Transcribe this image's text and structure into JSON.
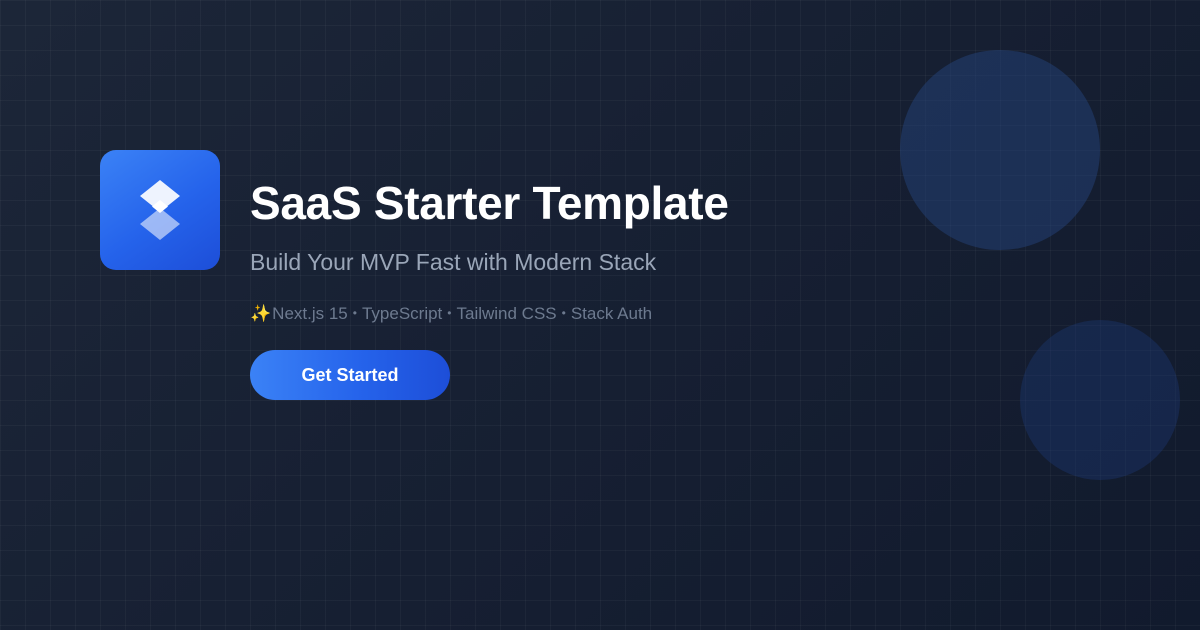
{
  "hero": {
    "title": "SaaS Starter Template",
    "subtitle": "Build Your MVP Fast with Modern Stack",
    "stack": {
      "icon": "sparkles-icon",
      "items": [
        "Next.js 15",
        "TypeScript",
        "Tailwind CSS",
        "Stack Auth"
      ],
      "separator": "•"
    },
    "cta_label": "Get Started"
  },
  "logo": {
    "icon": "layers-icon"
  },
  "colors": {
    "background": "#172033",
    "accent": "#2563eb",
    "accent_light": "#3b82f6",
    "title": "#ffffff",
    "subtitle": "#9aa6b8",
    "muted": "#6d7a8f"
  }
}
